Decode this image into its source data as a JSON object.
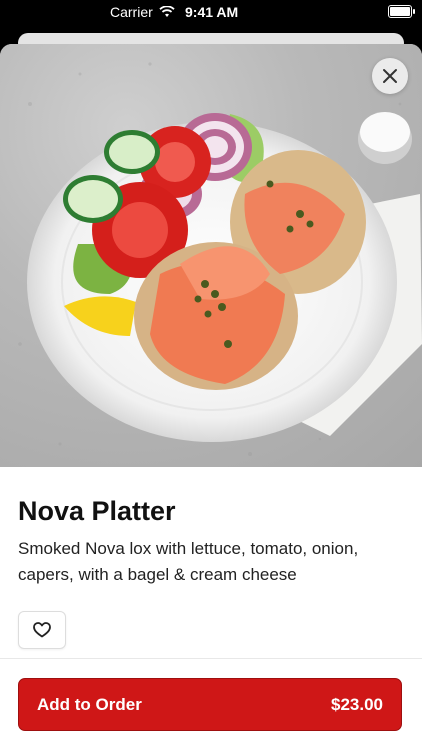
{
  "status_bar": {
    "carrier": "Carrier",
    "time": "9:41 AM"
  },
  "item": {
    "name": "Nova Platter",
    "description": "Smoked Nova lox with lettuce, tomato, onion, capers, with a bagel & cream cheese",
    "price": "$23.00"
  },
  "actions": {
    "add_label": "Add to Order",
    "favorite_icon": "heart-outline-icon",
    "close_icon": "close-icon"
  },
  "colors": {
    "accent": "#cf1717",
    "text": "#111111"
  }
}
